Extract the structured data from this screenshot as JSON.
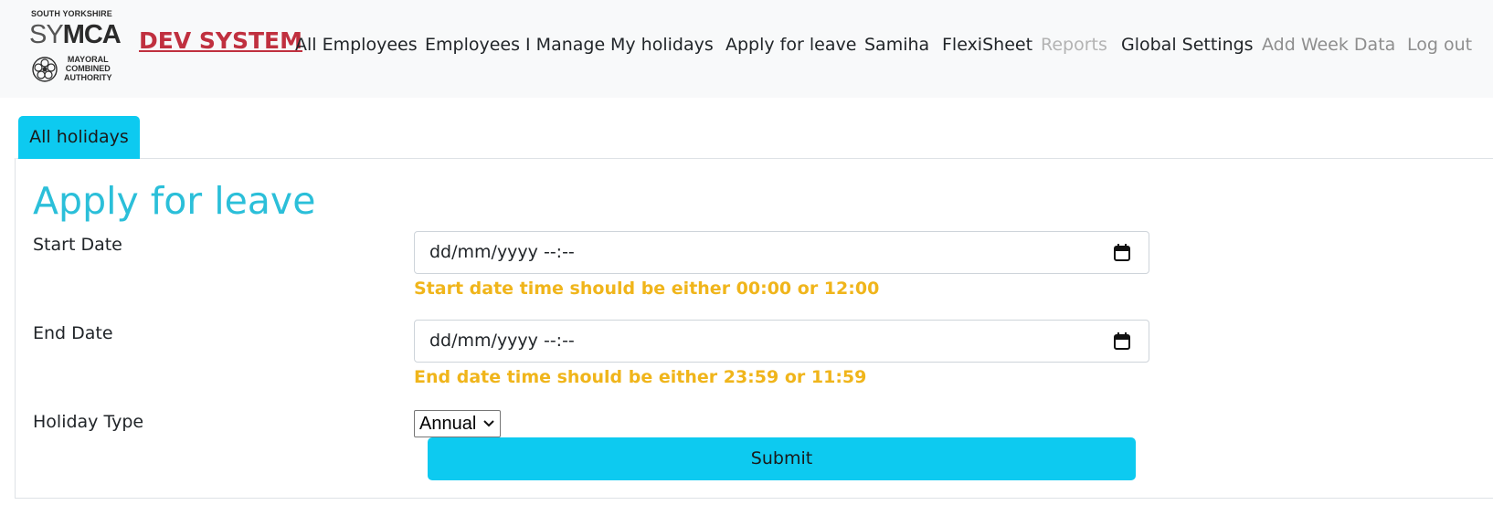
{
  "logo": {
    "line1": "SOUTH YORKSHIRE",
    "sy": "SY",
    "mca": "MCA",
    "sub1": "MAYORAL",
    "sub2": "COMBINED",
    "sub3": "AUTHORITY"
  },
  "brand": "DEV SYSTEM",
  "nav": {
    "all_employees": "All Employees",
    "employees_i_manage": "Employees I Manage",
    "my_holidays": "My holidays",
    "apply_for_leave": "Apply for leave",
    "samiha": "Samiha",
    "flexisheet": "FlexiSheet",
    "reports": "Reports",
    "global_settings": "Global Settings",
    "add_week_data": "Add Week Data",
    "log_out": "Log out"
  },
  "tabs": {
    "all_holidays": "All holidays"
  },
  "form": {
    "title": "Apply for leave",
    "start_label": "Start Date",
    "start_value": "dd/mm/yyyy --:--",
    "start_hint": "Start date time should be either 00:00 or 12:00",
    "end_label": "End Date",
    "end_value": "dd/mm/yyyy --:--",
    "end_hint": "End date time should be either 23:59 or 11:59",
    "type_label": "Holiday Type",
    "type_value": "Annual",
    "submit": "Submit"
  },
  "colors": {
    "accent": "#0dcaf0",
    "title": "#2bbfd9",
    "brand": "#c0303f",
    "hint": "#f0b51b"
  }
}
